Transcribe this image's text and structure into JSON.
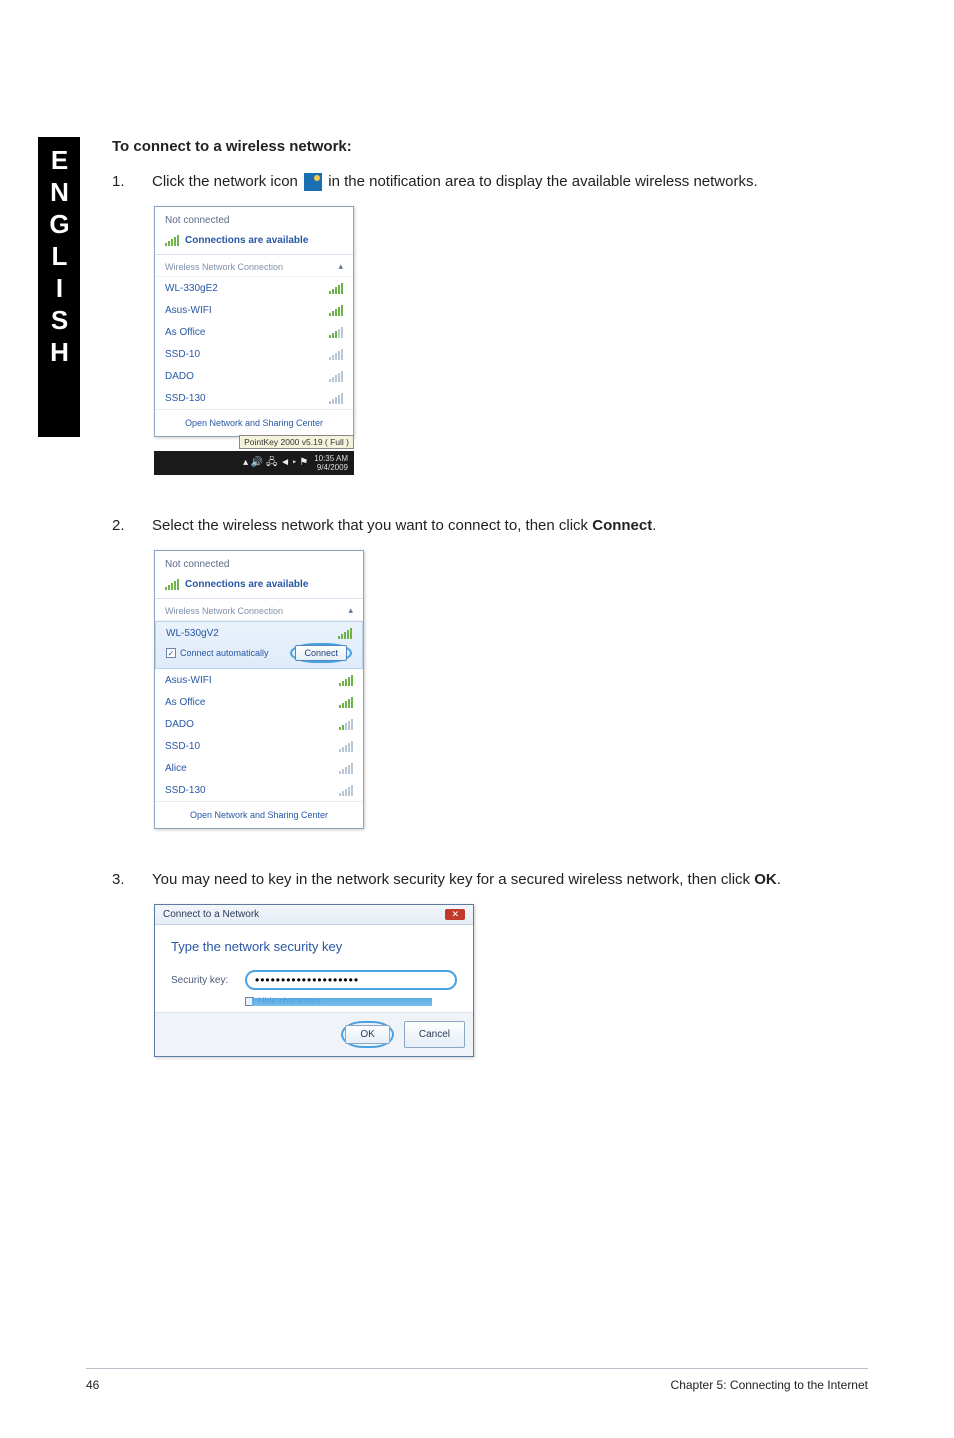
{
  "sideTab": "ENGLISH",
  "heading": "To connect to a wireless network:",
  "step1": {
    "num": "1.",
    "pre": "Click the network icon ",
    "post": " in the notification area to display the available wireless networks."
  },
  "popup1": {
    "notConnected": "Not connected",
    "available": "Connections are available",
    "sectionLabel": "Wireless Network Connection",
    "networks": [
      {
        "ssid": "WL-330gE2",
        "strength": "full"
      },
      {
        "ssid": "Asus-WIFI",
        "strength": "full"
      },
      {
        "ssid": "As Office",
        "strength": "mix"
      },
      {
        "ssid": "SSD-10",
        "strength": "grey"
      },
      {
        "ssid": "DADO",
        "strength": "grey"
      },
      {
        "ssid": "SSD-130",
        "strength": "grey"
      }
    ],
    "footerLink": "Open Network and Sharing Center",
    "tooltip": "PointKey 2000 v5.19 ( Full )",
    "clock": "10:35 AM",
    "date": "9/4/2009"
  },
  "step2": {
    "num": "2.",
    "text_pre": "Select the wireless network that you want to connect to, then click ",
    "bold": "Connect",
    "text_post": "."
  },
  "popup2": {
    "notConnected": "Not connected",
    "available": "Connections are available",
    "sectionLabel": "Wireless Network Connection",
    "selected": {
      "ssid": "WL-530gV2",
      "checkbox": "Connect automatically",
      "button": "Connect"
    },
    "networks": [
      {
        "ssid": "Asus-WIFI",
        "strength": "full"
      },
      {
        "ssid": "As Office",
        "strength": "full"
      },
      {
        "ssid": "DADO",
        "strength": "mix"
      },
      {
        "ssid": "SSD-10",
        "strength": "grey"
      },
      {
        "ssid": "Alice",
        "strength": "grey"
      },
      {
        "ssid": "SSD-130",
        "strength": "grey"
      }
    ],
    "footerLink": "Open Network and Sharing Center"
  },
  "step3": {
    "num": "3.",
    "text_pre": "You may need to key in the network security key for a secured wireless network, then click ",
    "bold": "OK",
    "text_post": "."
  },
  "dialog3": {
    "title": "Connect to a Network",
    "prompt": "Type the network security key",
    "fieldLabel": "Security key:",
    "fieldValue": "••••••••••••••••••••",
    "hide": "Hide characters",
    "ok": "OK",
    "cancel": "Cancel"
  },
  "footer": {
    "page": "46",
    "chapter": "Chapter 5: Connecting to the Internet"
  }
}
